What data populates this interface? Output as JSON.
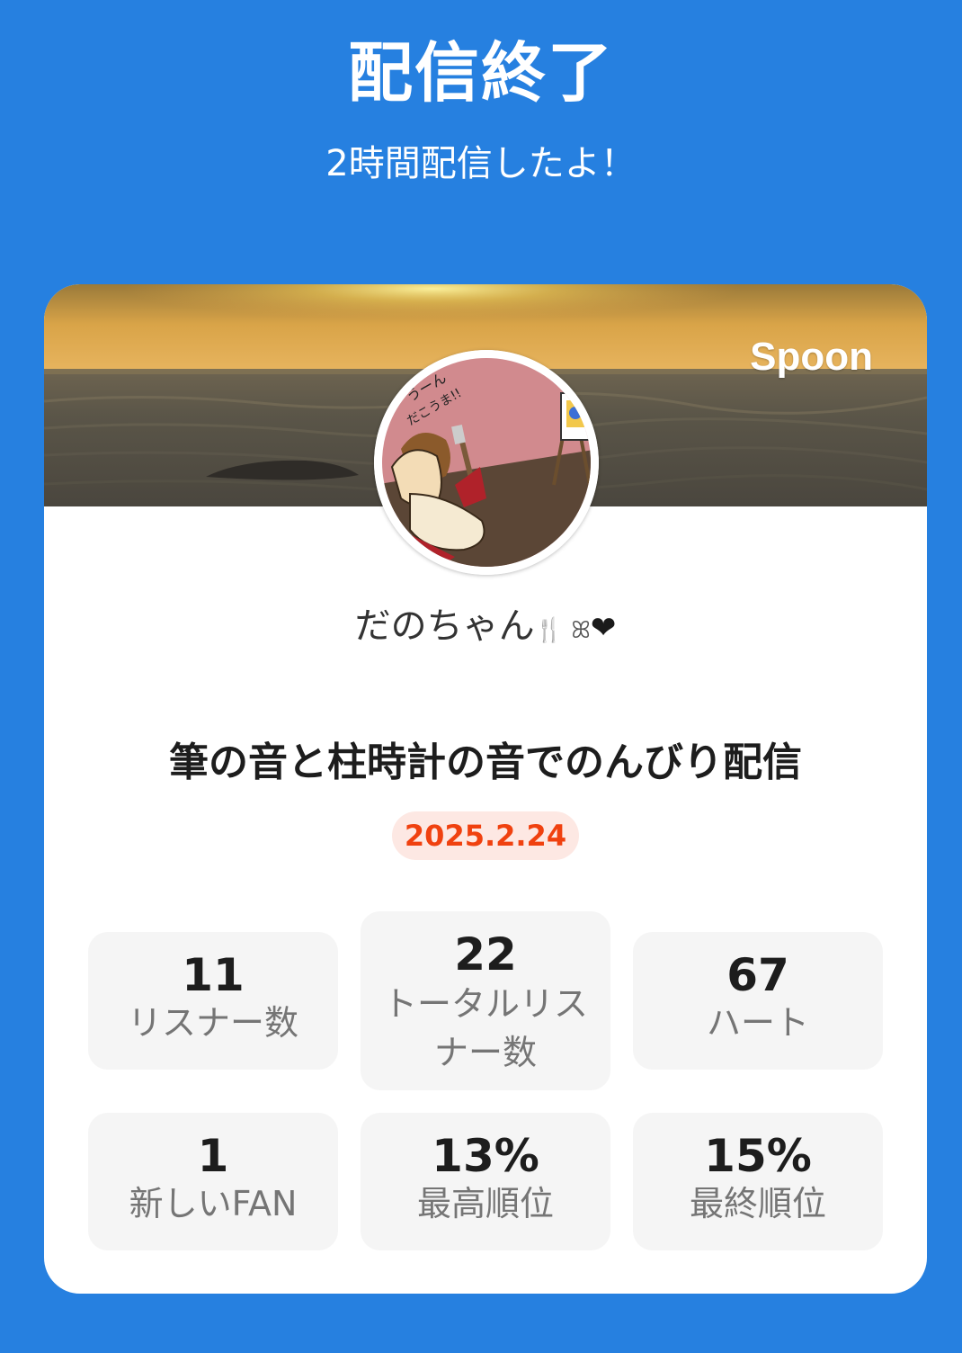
{
  "header": {
    "title": "配信終了",
    "subtitle": "2時間配信したよ！"
  },
  "card": {
    "brand": "Spoon",
    "username": "だのちゃん",
    "username_decoration": "🍴 ꕤ",
    "username_heart": "❤",
    "broadcast_title": "筆の音と柱時計の音でのんびり配信",
    "date": "2025.2.24",
    "avatar_text": "うーん だこうま!!",
    "colors": {
      "background": "#2680e0",
      "date_badge_bg": "#fde8e3",
      "date_badge_text": "#f0410f",
      "stat_bg": "#f5f5f5"
    },
    "stats": [
      {
        "value": "11",
        "label": "リスナー数"
      },
      {
        "value": "22",
        "label": "トータルリスナー数"
      },
      {
        "value": "67",
        "label": "ハート"
      },
      {
        "value": "1",
        "label": "新しいFAN"
      },
      {
        "value": "13%",
        "label": "最高順位"
      },
      {
        "value": "15%",
        "label": "最終順位"
      }
    ]
  }
}
